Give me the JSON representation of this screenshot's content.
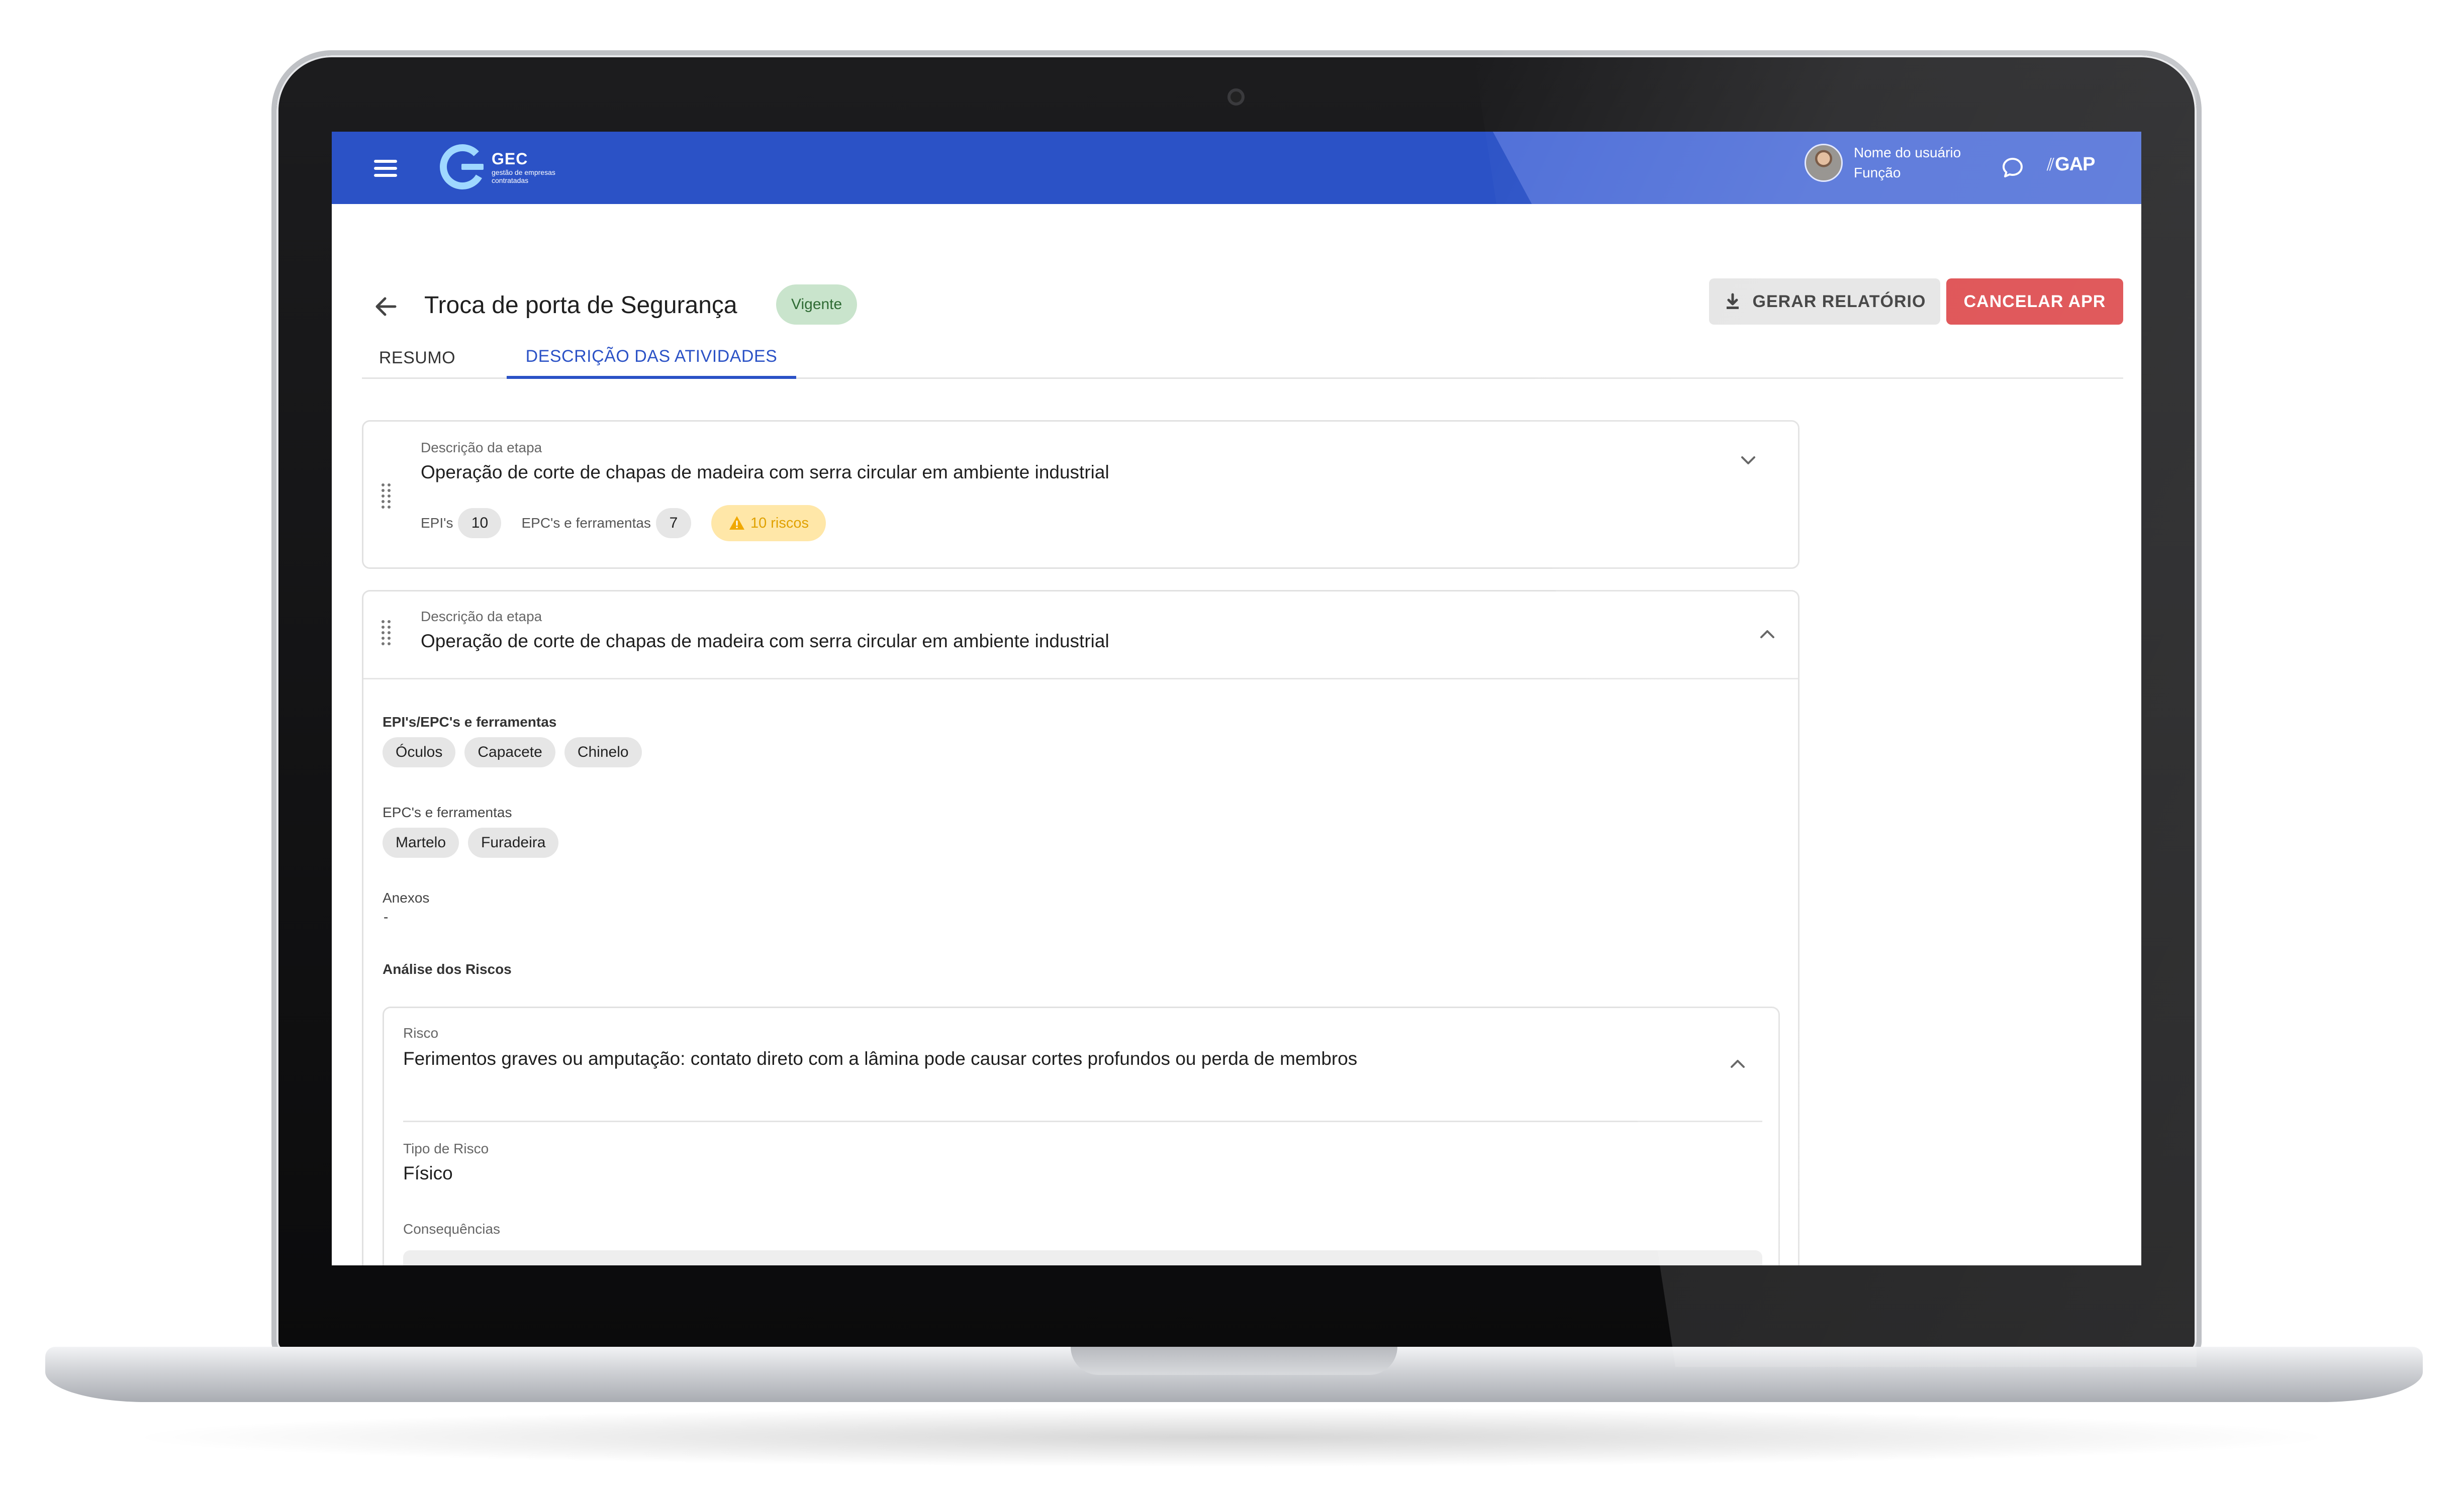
{
  "header": {
    "logo_title": "GEC",
    "logo_subtitle": "gestão de empresas contratadas",
    "user_name": "Nome do usuário",
    "user_role": "Função",
    "gap_logo": "GAP",
    "colors": {
      "primary": "#2b52c6",
      "danger": "#dc4447",
      "success_bg": "#c9e4cc",
      "warning_bg": "#ffe7a8"
    }
  },
  "page": {
    "title": "Troca de porta de Segurança",
    "status": "Vigente",
    "report_button": "GERAR RELATÓRIO",
    "cancel_button": "CANCELAR APR"
  },
  "tabs": [
    {
      "label": "RESUMO",
      "active": false
    },
    {
      "label": "DESCRIÇÃO DAS ATIVIDADES",
      "active": true
    }
  ],
  "steps": [
    {
      "label": "Descrição da etapa",
      "value": "Operação de corte de chapas de madeira com serra circular em ambiente industrial",
      "epi_label": "EPI's",
      "epi_count": "10",
      "epc_label": "EPC's e ferramentas",
      "epc_count": "7",
      "risk_count": "10 riscos",
      "expanded": false
    },
    {
      "label": "Descrição da etapa",
      "value": "Operação de corte de chapas de madeira com serra circular em ambiente industrial",
      "expanded": true,
      "epi_section_label": "EPI's/EPC's e ferramentas",
      "epi_items": [
        "Óculos",
        "Capacete",
        "Chinelo"
      ],
      "epc_section_label": "EPC's e ferramentas",
      "epc_items": [
        "Martelo",
        "Furadeira"
      ],
      "attachments_label": "Anexos",
      "attachments_value": "-",
      "risk_analysis_label": "Análise dos Riscos",
      "risk": {
        "label": "Risco",
        "value": "Ferimentos graves ou amputação: contato direto com a lâmina pode causar cortes profundos ou perda de membros",
        "type_label": "Tipo de Risco",
        "type_value": "Físico",
        "consequences_label": "Consequências"
      }
    }
  ],
  "icons": [
    "menu-icon",
    "gec-logo-icon",
    "avatar",
    "chat-icon",
    "back-arrow-icon",
    "download-icon",
    "drag-handle-icon",
    "chevron-down-icon",
    "chevron-up-icon",
    "warning-icon"
  ]
}
